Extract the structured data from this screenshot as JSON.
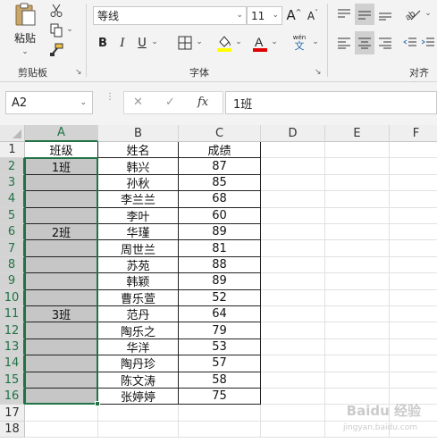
{
  "ribbon": {
    "clipboard": {
      "paste_label": "粘贴",
      "group_label": "剪贴板"
    },
    "font": {
      "font_name": "等线",
      "font_size": "11",
      "bold": "B",
      "italic": "I",
      "underline": "U",
      "underline_dropdown": "⌄",
      "grow_label": "A",
      "shrink_label": "A",
      "phonetic_top": "wén",
      "phonetic_bottom": "文",
      "group_label": "字体"
    },
    "alignment": {
      "group_label": "对齐方"
    },
    "colors": {
      "highlight": "#ffff00",
      "font_color": "#e00000",
      "accent": "#217346"
    }
  },
  "formula_bar": {
    "name_box": "A2",
    "cancel_icon": "✕",
    "enter_icon": "✓",
    "fx_label": "fx",
    "formula": "1班"
  },
  "sheet": {
    "columns": [
      "A",
      "B",
      "C",
      "D",
      "E",
      "F"
    ],
    "rows": [
      "1",
      "2",
      "3",
      "4",
      "5",
      "6",
      "7",
      "8",
      "9",
      "10",
      "11",
      "12",
      "13",
      "14",
      "15",
      "16",
      "17",
      "18"
    ],
    "cells": {
      "A": [
        "班级",
        "1班",
        "",
        "",
        "",
        "2班",
        "",
        "",
        "",
        "",
        "3班",
        "",
        "",
        "",
        "",
        ""
      ],
      "B": [
        "姓名",
        "韩兴",
        "孙秋",
        "李兰兰",
        "李叶",
        "华瑾",
        "周世兰",
        "苏苑",
        "韩颖",
        "曹乐萱",
        "范丹",
        "陶乐之",
        "华洋",
        "陶丹珍",
        "陈文涛",
        "张婷婷"
      ],
      "C": [
        "成绩",
        "87",
        "85",
        "68",
        "60",
        "89",
        "81",
        "88",
        "89",
        "52",
        "64",
        "79",
        "53",
        "57",
        "58",
        "75"
      ]
    }
  },
  "watermark": {
    "text": "Baidu 经验",
    "subtext": "jingyan.baidu.com"
  }
}
